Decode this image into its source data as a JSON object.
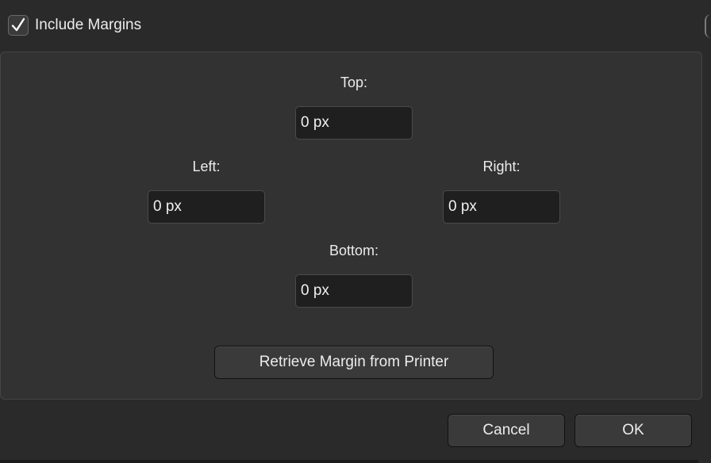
{
  "checkbox": {
    "label": "Include Margins",
    "checked": true,
    "check_glyph": "✓"
  },
  "margins": {
    "top": {
      "label": "Top:",
      "value": "0 px"
    },
    "left": {
      "label": "Left:",
      "value": "0 px"
    },
    "right": {
      "label": "Right:",
      "value": "0 px"
    },
    "bottom": {
      "label": "Bottom:",
      "value": "0 px"
    }
  },
  "buttons": {
    "retrieve": "Retrieve Margin from Printer",
    "cancel": "Cancel",
    "ok": "OK"
  },
  "colors": {
    "background": "#2a2a2a",
    "panel": "#323232",
    "field": "#1f1f1f",
    "button": "#3a3a3a"
  }
}
